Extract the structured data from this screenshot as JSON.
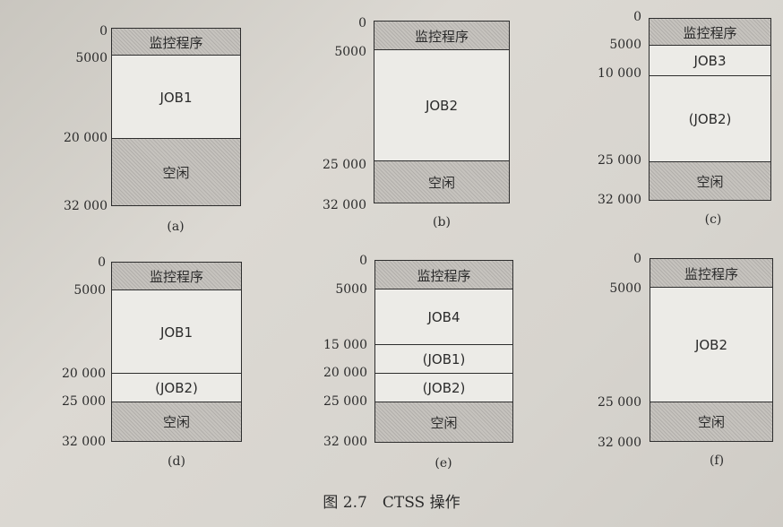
{
  "figure": {
    "caption": "图 2.7　CTSS 操作",
    "panels": [
      {
        "label": "(a)",
        "addresses": [
          "0",
          "5000",
          "20 000",
          "32 000"
        ],
        "blocks": [
          {
            "text": "监控程序",
            "fill": "hatched"
          },
          {
            "text": "JOB1",
            "fill": "white"
          },
          {
            "text": "空闲",
            "fill": "hatched"
          }
        ]
      },
      {
        "label": "(b)",
        "addresses": [
          "0",
          "5000",
          "25 000",
          "32 000"
        ],
        "blocks": [
          {
            "text": "监控程序",
            "fill": "hatched"
          },
          {
            "text": "JOB2",
            "fill": "white"
          },
          {
            "text": "空闲",
            "fill": "hatched"
          }
        ]
      },
      {
        "label": "(c)",
        "addresses": [
          "0",
          "5000",
          "10 000",
          "25 000",
          "32 000"
        ],
        "blocks": [
          {
            "text": "监控程序",
            "fill": "hatched"
          },
          {
            "text": "JOB3",
            "fill": "white"
          },
          {
            "text": "(JOB2)",
            "fill": "white"
          },
          {
            "text": "空闲",
            "fill": "hatched"
          }
        ]
      },
      {
        "label": "(d)",
        "addresses": [
          "0",
          "5000",
          "20 000",
          "25 000",
          "32 000"
        ],
        "blocks": [
          {
            "text": "监控程序",
            "fill": "hatched"
          },
          {
            "text": "JOB1",
            "fill": "white"
          },
          {
            "text": "(JOB2)",
            "fill": "white"
          },
          {
            "text": "空闲",
            "fill": "hatched"
          }
        ]
      },
      {
        "label": "(e)",
        "addresses": [
          "0",
          "5000",
          "15 000",
          "20 000",
          "25 000",
          "32 000"
        ],
        "blocks": [
          {
            "text": "监控程序",
            "fill": "hatched"
          },
          {
            "text": "JOB4",
            "fill": "white"
          },
          {
            "text": "(JOB1)",
            "fill": "white"
          },
          {
            "text": "(JOB2)",
            "fill": "white"
          },
          {
            "text": "空闲",
            "fill": "hatched"
          }
        ]
      },
      {
        "label": "(f)",
        "addresses": [
          "0",
          "5000",
          "25 000",
          "32 000"
        ],
        "blocks": [
          {
            "text": "监控程序",
            "fill": "hatched"
          },
          {
            "text": "JOB2",
            "fill": "white"
          },
          {
            "text": "空闲",
            "fill": "hatched"
          }
        ]
      }
    ]
  }
}
